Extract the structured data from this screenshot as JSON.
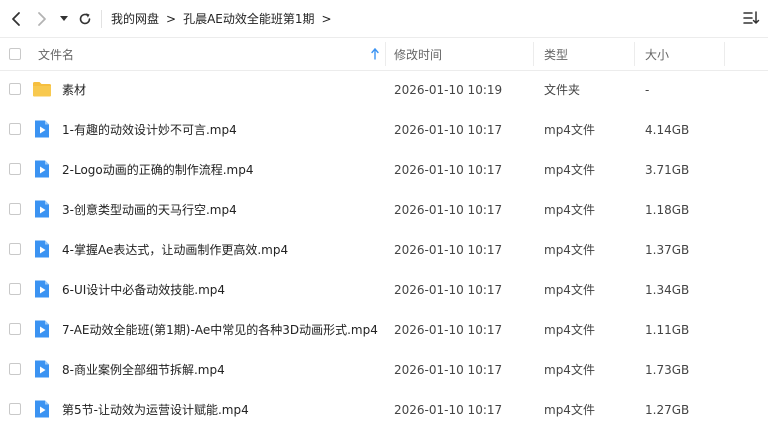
{
  "breadcrumb": {
    "items": [
      "我的网盘",
      "孔晨AE动效全能班第1期"
    ],
    "separator": ">"
  },
  "columns": {
    "name": "文件名",
    "modified": "修改时间",
    "type": "类型",
    "size": "大小"
  },
  "files": [
    {
      "name": "素材",
      "modified": "2026-01-10 10:19",
      "type": "文件夹",
      "size": "-",
      "icon": "folder-icon"
    },
    {
      "name": "1-有趣的动效设计妙不可言.mp4",
      "modified": "2026-01-10 10:17",
      "type": "mp4文件",
      "size": "4.14GB",
      "icon": "video-file-icon"
    },
    {
      "name": "2-Logo动画的正确的制作流程.mp4",
      "modified": "2026-01-10 10:17",
      "type": "mp4文件",
      "size": "3.71GB",
      "icon": "video-file-icon"
    },
    {
      "name": "3-创意类型动画的天马行空.mp4",
      "modified": "2026-01-10 10:17",
      "type": "mp4文件",
      "size": "1.18GB",
      "icon": "video-file-icon"
    },
    {
      "name": "4-掌握Ae表达式，让动画制作更高效.mp4",
      "modified": "2026-01-10 10:17",
      "type": "mp4文件",
      "size": "1.37GB",
      "icon": "video-file-icon"
    },
    {
      "name": "6-UI设计中必备动效技能.mp4",
      "modified": "2026-01-10 10:17",
      "type": "mp4文件",
      "size": "1.34GB",
      "icon": "video-file-icon"
    },
    {
      "name": "7-AE动效全能班(第1期)-Ae中常见的各种3D动画形式.mp4",
      "modified": "2026-01-10 10:17",
      "type": "mp4文件",
      "size": "1.11GB",
      "icon": "video-file-icon"
    },
    {
      "name": "8-商业案例全部细节拆解.mp4",
      "modified": "2026-01-10 10:17",
      "type": "mp4文件",
      "size": "1.73GB",
      "icon": "video-file-icon"
    },
    {
      "name": "第5节-让动效为运营设计赋能.mp4",
      "modified": "2026-01-10 10:17",
      "type": "mp4文件",
      "size": "1.27GB",
      "icon": "video-file-icon"
    }
  ],
  "colors": {
    "folder": "#f6bf3f",
    "video": "#3b93f2",
    "sort_arrow": "#3b93f2",
    "border": "#ececec"
  }
}
